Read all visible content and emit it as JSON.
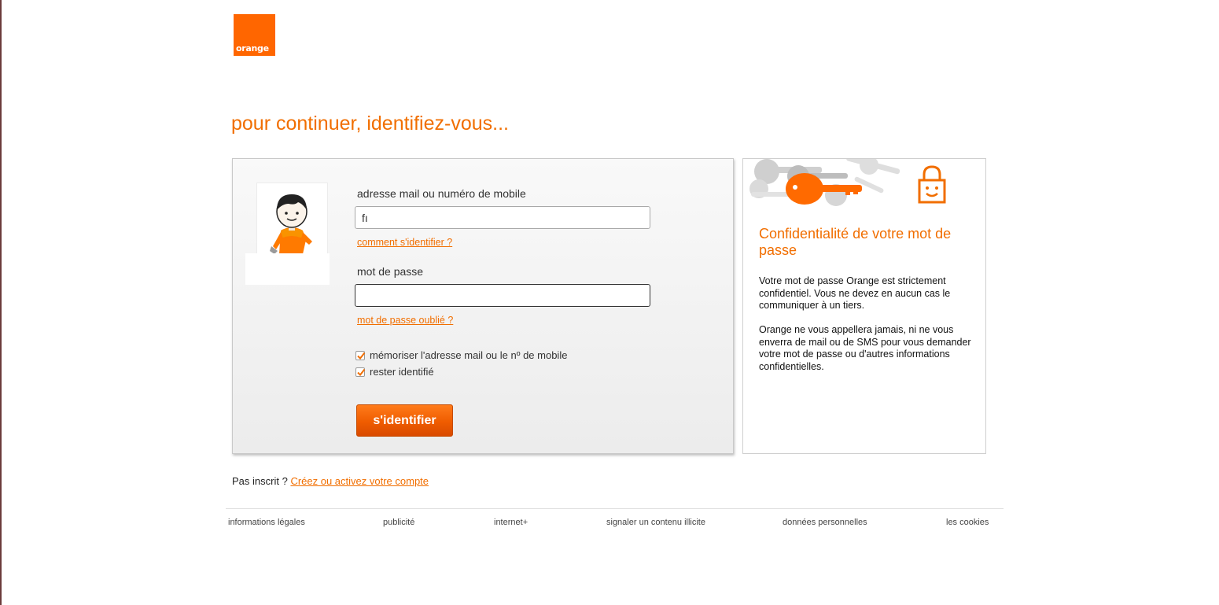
{
  "brand": {
    "logo_text": "orange",
    "accent_color": "#f16e00"
  },
  "headline": "pour continuer, identifiez-vous...",
  "login": {
    "id_label": "adresse mail ou numéro de mobile",
    "id_value": "fı",
    "how_to_link": "comment s'identifier ?",
    "password_label": "mot de passe",
    "password_value": "",
    "forgot_link": "mot de passe oublié ?",
    "remember_label": "mémoriser l'adresse mail ou le nº de mobile",
    "remember_checked": true,
    "stay_label": "rester identifié",
    "stay_checked": true,
    "submit_label": "s'identifier"
  },
  "info": {
    "title": "Confidentialité de votre mot de passe",
    "paragraph1": "Votre mot de passe Orange est strictement confidentiel. Vous ne devez en aucun cas le communiquer à un tiers.",
    "paragraph2": "Orange ne vous appellera jamais, ni ne vous enverra de mail ou de SMS pour vous demander votre mot de passe ou d'autres informations confidentielles."
  },
  "signup": {
    "prompt": "Pas inscrit ?",
    "link": "Créez ou activez votre compte"
  },
  "footer": {
    "legal": "informations légales",
    "ads": "publicité",
    "internet": "internet+",
    "report": "signaler un contenu illicite",
    "personal_data": "données personnelles",
    "cookies": "les cookies"
  },
  "icons": [
    "orange-logo",
    "user-avatar-icon",
    "keys-illustration",
    "smiling-lock-icon",
    "checkmark-icon"
  ]
}
